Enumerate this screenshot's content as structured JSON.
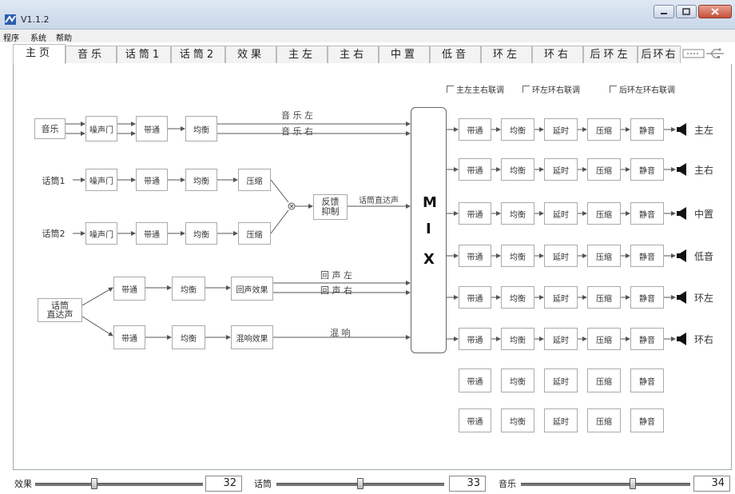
{
  "window": {
    "title": "V1.1.2"
  },
  "menu": [
    "程序",
    "系统",
    "帮助"
  ],
  "tabs": [
    "主页",
    "音乐",
    "话筒1",
    "话筒2",
    "效果",
    "主左",
    "主右",
    "中置",
    "低音",
    "环左",
    "环右",
    "后环左",
    "后环右"
  ],
  "link_options": [
    "主左主右联调",
    "环左环右联调",
    "后环左环右联调"
  ],
  "sources": {
    "music": "音乐",
    "mic1": "话筒1",
    "mic2": "话筒2",
    "mic_direct": "话筒\n直达声"
  },
  "blocks": {
    "noise_gate": "噪声门",
    "bandpass": "带通",
    "eq": "均衡",
    "compress": "压缩",
    "feedback": "反馈\n抑制",
    "echo": "回声效果",
    "reverb": "混响效果",
    "delay": "延时",
    "mute": "静音"
  },
  "signals": {
    "music_left": "音 乐 左",
    "music_right": "音 乐 右",
    "mic_direct": "话筒直达声",
    "echo_left": "回 声 左",
    "echo_right": "回 声 右",
    "reverb": "混 响"
  },
  "mix_letters": [
    "M",
    "I",
    "X"
  ],
  "outputs": [
    "主左",
    "主右",
    "中置",
    "低音",
    "环左",
    "环右"
  ],
  "sliders": [
    {
      "label": "效果",
      "value": "32",
      "level": 0.35
    },
    {
      "label": "话筒",
      "value": "33",
      "level": 0.5
    },
    {
      "label": "音乐",
      "value": "34",
      "level": 0.66
    }
  ],
  "colors": {
    "title_bg": "#c9d7ea",
    "close_btn": "#c7503a",
    "line": "#555555",
    "box_border": "#aaaaaa"
  }
}
